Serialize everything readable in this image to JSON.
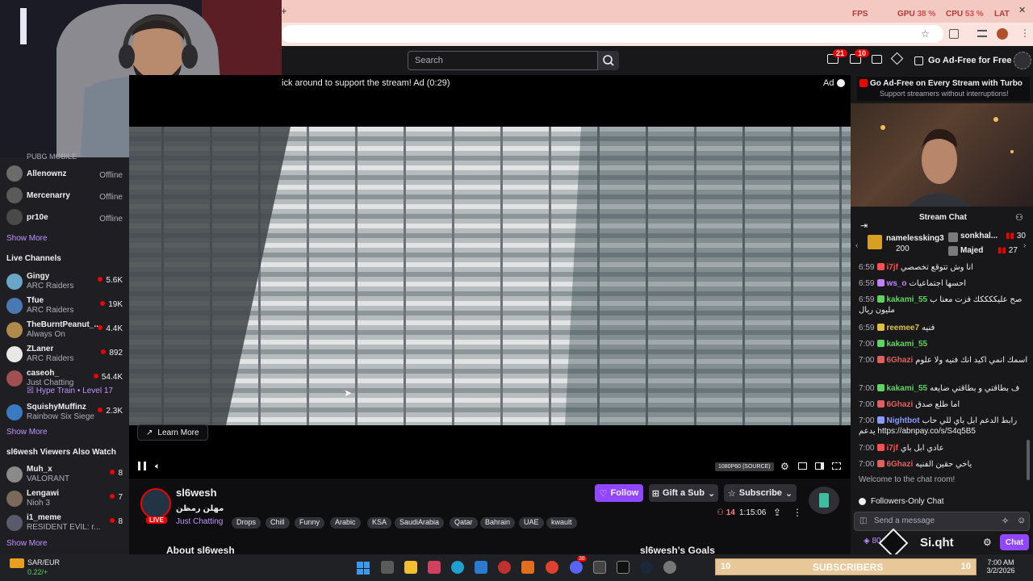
{
  "perf": {
    "fps_label": "FPS",
    "fps_value": "",
    "gpu_label": "GPU",
    "gpu_value": "38 %",
    "cpu_label": "CPU",
    "cpu_value": "53 %",
    "lat_label": "LAT",
    "lat_value": "%"
  },
  "browser": {
    "new_tab": "+",
    "minimize": "—",
    "close": "✕"
  },
  "topnav": {
    "search_placeholder": "Search",
    "notif_count": "21",
    "inbox_count": "10",
    "ad_free": "Go Ad-Free for Free"
  },
  "sidebar": {
    "followed_cut": "PUBG MOBILE",
    "offline": [
      {
        "name": "Allenownz",
        "status": "Offline",
        "color": "#6b6b6b"
      },
      {
        "name": "Mercenarry",
        "status": "Offline",
        "color": "#5a5a5a"
      },
      {
        "name": "pr10e",
        "status": "Offline",
        "color": "#4a4a4a"
      }
    ],
    "show_more_1": "Show More",
    "live_header": "Live Channels",
    "live": [
      {
        "name": "Gingy",
        "game": "ARC Raiders",
        "viewers": "5.6K",
        "color": "#6aa6c8"
      },
      {
        "name": "Tfue",
        "game": "ARC Raiders",
        "viewers": "19K",
        "color": "#4a78b0"
      },
      {
        "name": "TheBurntPeanut_...",
        "game": "Always On",
        "viewers": "4.4K",
        "color": "#b08a4a"
      },
      {
        "name": "ZLaner",
        "game": "ARC Raiders",
        "viewers": "892",
        "color": "#e8e8e8"
      },
      {
        "name": "caseoh_",
        "game": "Just Chatting",
        "viewers": "54.4K",
        "color": "#a05050"
      },
      {
        "name": "SquishyMuffinz",
        "game": "Rainbow Six Siege",
        "viewers": "2.3K",
        "color": "#3a7ac0"
      }
    ],
    "hype_train": "Hype Train • Level 17",
    "show_more_2": "Show More",
    "also_header": "sl6wesh Viewers Also Watch",
    "also": [
      {
        "name": "Muh_x",
        "game": "VALORANT",
        "viewers": "8",
        "color": "#8a8a8a"
      },
      {
        "name": "Lengawi",
        "game": "Nioh 3",
        "viewers": "7",
        "color": "#7a6a5a"
      },
      {
        "name": "i1_meme",
        "game": "RESIDENT EVIL: r...",
        "viewers": "8",
        "color": "#5a5a6a"
      }
    ],
    "show_more_3": "Show More"
  },
  "player": {
    "ad_text": "ick around to support the stream! Ad (0:29)",
    "ad_label": "Ad",
    "learn_more": "Learn More",
    "quality": "1080P60 (SOURCE)"
  },
  "channel": {
    "name": "sl6wesh",
    "title": "مهلن رمظن",
    "category": "Just Chatting",
    "live": "LIVE",
    "tags": [
      "Drops",
      "Chill",
      "Funny",
      "Arabic",
      "KSA",
      "SaudiArabia",
      "Qatar",
      "Bahrain",
      "UAE",
      "kwault"
    ],
    "follow": "Follow",
    "gift": "Gift a Sub",
    "subscribe": "Subscribe",
    "viewers": "14",
    "uptime": "1:15:06",
    "about": "About sl6wesh",
    "goals": "sl6wesh's Goals"
  },
  "chat": {
    "promo_title": "Go Ad-Free on Every Stream with Turbo",
    "promo_sub": "Support streamers without interruptions!",
    "header": "Stream Chat",
    "gifter1_name": "namelessking3",
    "gifter1_count": "200",
    "gifter2_name": "sonkhal...",
    "gifter2_count": "30",
    "gifter3_name": "Majed",
    "gifter3_count": "27",
    "messages": [
      {
        "time": "6:59",
        "user": "i7jf",
        "color": "#ff4f4f",
        "text": "انا وش تتوقع تخصصي"
      },
      {
        "time": "6:59",
        "user": "ws_o",
        "color": "#c080ff",
        "text": "احسها اجتماعيات"
      },
      {
        "time": "6:59",
        "user": "kakami_55",
        "color": "#5fd35f",
        "text": "صح عليككككك فزت معنا ب مليون ريال"
      },
      {
        "time": "6:59",
        "user": "reemee7",
        "color": "#e0c040",
        "text": "فنيه"
      },
      {
        "time": "7:00",
        "user": "kakami_55",
        "color": "#5fd35f",
        "text": ""
      },
      {
        "time": "7:00",
        "user": "6Ghazi",
        "color": "#e06060",
        "text": "اسمك انمي اكيد انك فنيه ولا علوم"
      },
      {
        "time": "7:00",
        "user": "kakami_55",
        "color": "#5fd35f",
        "text": "ف بطاقتي و بطاقتي ضايعه"
      },
      {
        "time": "7:00",
        "user": "6Ghazi",
        "color": "#e06060",
        "text": "اما طلع صدق"
      },
      {
        "time": "7:00",
        "user": "Nightbot",
        "color": "#8a9aff",
        "text": "رابط الدعم ابل باي للي حاب يدعم https://abnpay.co/s/S4q5B5"
      },
      {
        "time": "7:00",
        "user": "i7jf",
        "color": "#ff4f4f",
        "text": "عادي ابل باي"
      },
      {
        "time": "7:00",
        "user": "6Ghazi",
        "color": "#e06060",
        "text": "ياخي حقين الفنيه"
      }
    ],
    "welcome": "Welcome to the chat room!",
    "followers_only": "Followers-Only Chat",
    "input_placeholder": "Send a message",
    "points": "80",
    "overlay_name": "Si.qht",
    "chat_button": "Chat"
  },
  "taskbar": {
    "currency": "SAR/EUR",
    "currency_change": "0.22/+",
    "sub_left": "10",
    "sub_label": "SUBSCRIBERS",
    "sub_right": "10",
    "time": "7:00 AM",
    "date": "3/2/2026",
    "discord_badge": "38"
  },
  "colors": {
    "twitch_purple": "#9147ff",
    "live_red": "#eb0400",
    "link": "#bf94ff"
  }
}
